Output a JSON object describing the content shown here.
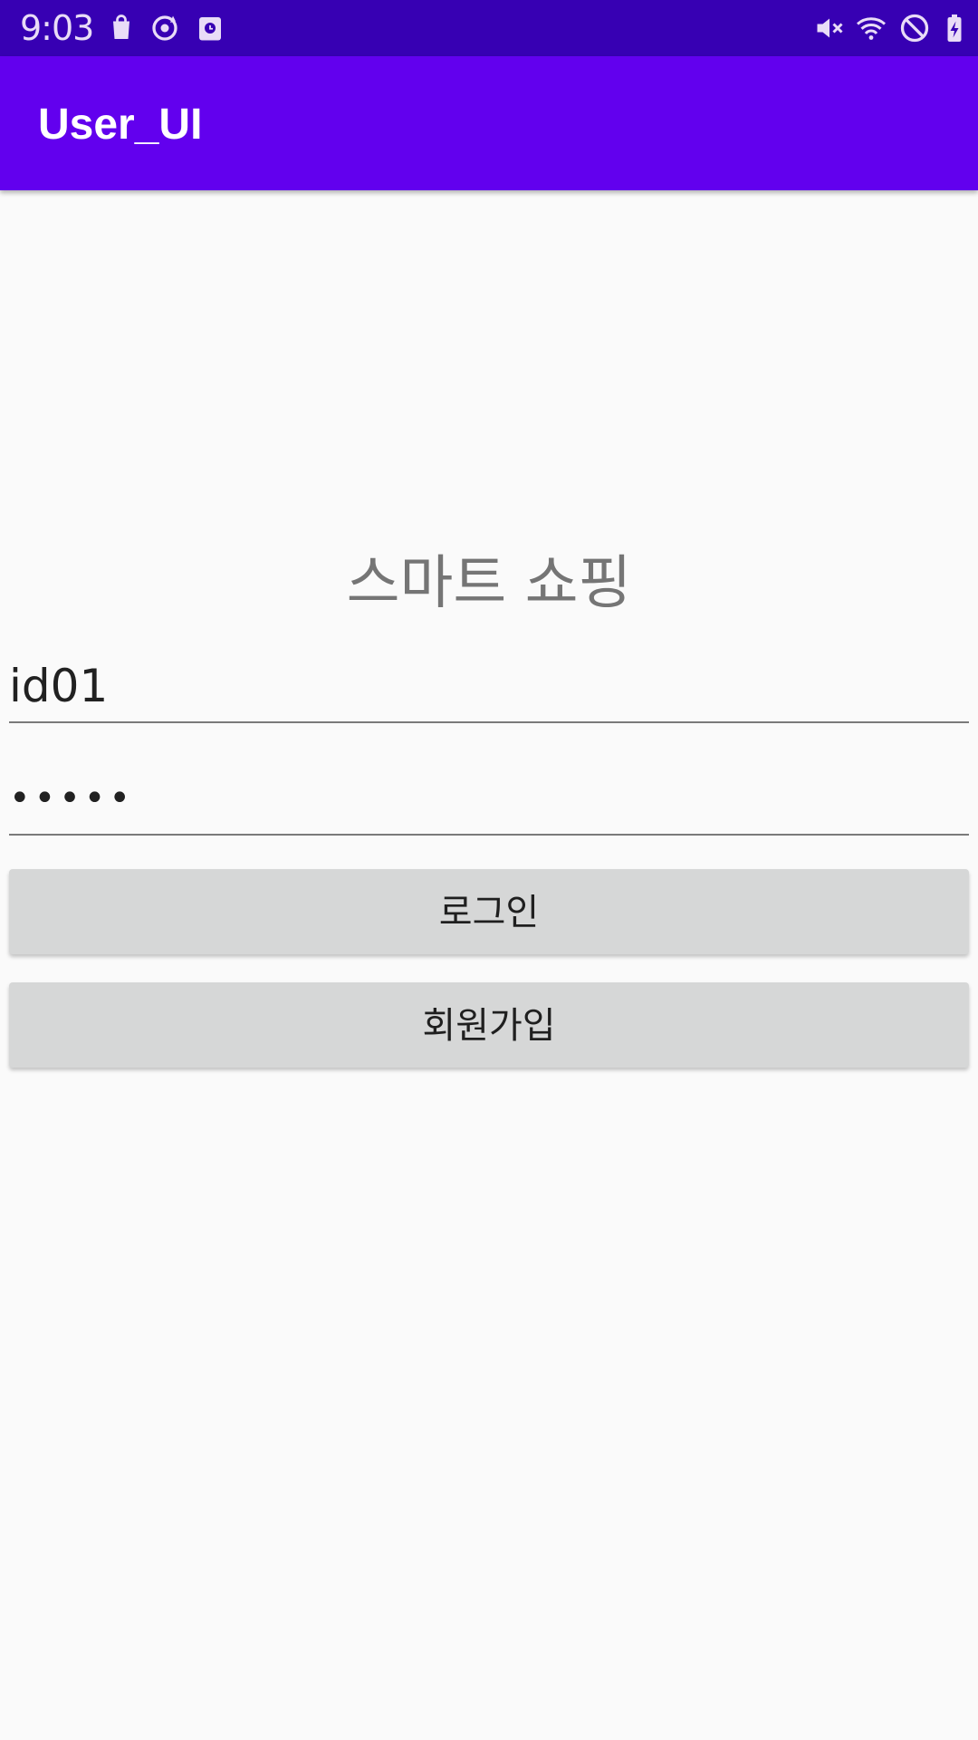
{
  "status_bar": {
    "time": "9:03",
    "left_icons": [
      "shopping-bag-icon",
      "sync-icon",
      "calendar-icon"
    ],
    "right_icons": [
      "mute-icon",
      "wifi-icon",
      "do-not-disturb-icon",
      "battery-charging-icon"
    ],
    "colors": {
      "background": "#3700b3",
      "icon": "#e9dcf7"
    }
  },
  "app_bar": {
    "title": "User_UI",
    "color": "#6200ee"
  },
  "login": {
    "heading": "스마트 쇼핑",
    "id_value": "id01",
    "password_value": "•••••",
    "login_label": "로그인",
    "signup_label": "회원가입"
  }
}
